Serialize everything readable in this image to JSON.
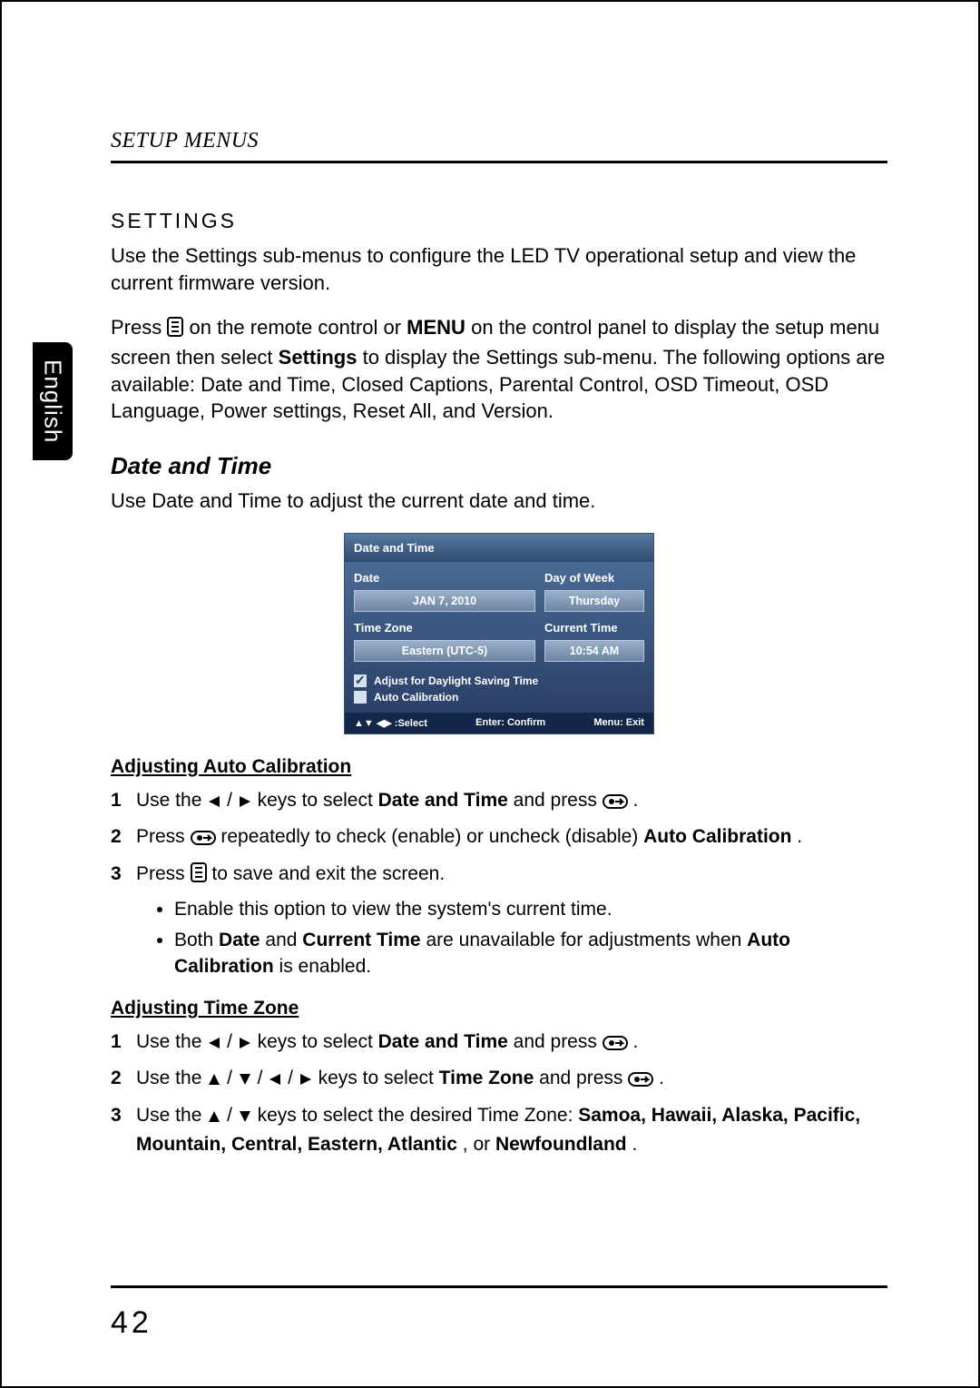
{
  "header": {
    "section": "SETUP MENUS"
  },
  "sidebar": {
    "lang": "English"
  },
  "settings": {
    "heading": "SETTINGS",
    "intro": "Use the Settings sub-menus to configure the LED TV operational setup and view the current firmware version.",
    "press_pre": "Press ",
    "press_mid1": " on the remote control or ",
    "menu_word": "MENU",
    "press_mid2": " on the control panel to display the setup menu screen then select ",
    "settings_word": "Settings",
    "press_tail": " to display the Settings sub-menu. The following options are available: Date and Time, Closed Captions, Parental Control, OSD Timeout, OSD Language, Power settings, Reset All, and Version."
  },
  "datetime": {
    "heading": "Date and Time",
    "intro": "Use Date and Time to adjust the current date and time."
  },
  "osd": {
    "title": "Date and Time",
    "date_label": "Date",
    "date_value": "JAN 7, 2010",
    "dow_label": "Day of Week",
    "dow_value": "Thursday",
    "tz_label": "Time Zone",
    "tz_value": "Eastern (UTC-5)",
    "time_label": "Current Time",
    "time_value": "10:54 AM",
    "dst": "Adjust for Daylight Saving Time",
    "auto": "Auto Calibration",
    "footer_select": "▲▼ ◀▶ :Select",
    "footer_enter": "Enter: Confirm",
    "footer_menu": "Menu: Exit"
  },
  "auto_cal": {
    "heading": "Adjusting Auto Calibration",
    "s1_pre": "Use the ",
    "s1_mid": " keys to select ",
    "s1_bold": "Date and Time",
    "s1_mid2": " and press ",
    "s1_end": ".",
    "s2_pre": "Press ",
    "s2_mid": " repeatedly to check (enable) or uncheck (disable) ",
    "s2_bold": "Auto Calibration",
    "s2_end": ".",
    "s3_pre": "Press ",
    "s3_end": " to save and exit the screen.",
    "b1": "Enable this option to view the system's current time.",
    "b2_pre": "Both ",
    "b2_b1": "Date",
    "b2_mid1": " and ",
    "b2_b2": "Current Time",
    "b2_mid2": " are unavailable for adjustments when ",
    "b2_b3": "Auto Calibration",
    "b2_end": " is enabled."
  },
  "timezone": {
    "heading": "Adjusting Time Zone",
    "s1_pre": "Use the ",
    "s1_mid": " keys to select ",
    "s1_bold": "Date and Time",
    "s1_mid2": " and press ",
    "s1_end": ".",
    "s2_pre": "Use the ",
    "s2_mid": " keys to select ",
    "s2_bold": "Time Zone",
    "s2_mid2": " and press ",
    "s2_end": ".",
    "s3_pre": "Use the ",
    "s3_mid": " keys to select the desired Time Zone: ",
    "s3_list": "Samoa, Hawaii, Alaska, Pacific, Mountain, Central, Eastern, Atlantic",
    "s3_or": ", or ",
    "s3_last": "Newfoundland",
    "s3_end": "."
  },
  "page_number": "42"
}
